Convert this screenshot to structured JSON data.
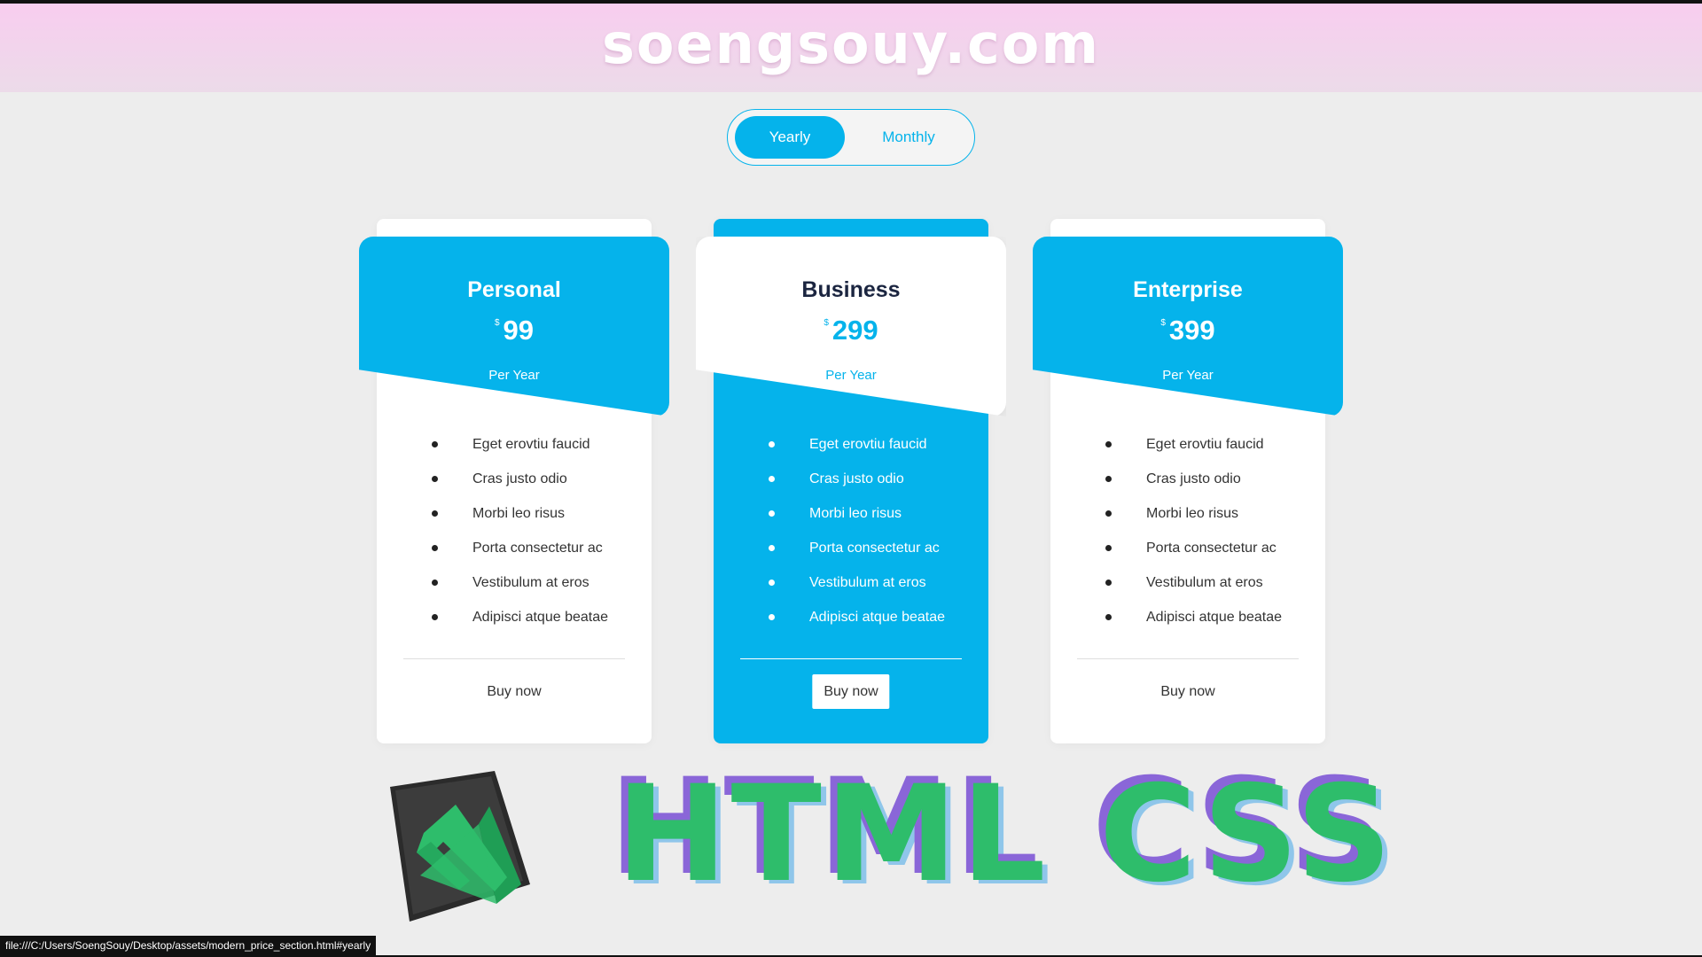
{
  "banner": {
    "title": "soengsouy.com"
  },
  "toggle": {
    "active": "Yearly",
    "inactive": "Monthly"
  },
  "colors": {
    "accent": "#05b3eb",
    "background": "#ededed",
    "banner": "#f8cdef",
    "logo_green": "#2ebd6b"
  },
  "plans": [
    {
      "name": "Personal",
      "currency": "$",
      "price": "99",
      "period": "Per Year",
      "features": [
        "Eget erovtiu faucid",
        "Cras justo odio",
        "Morbi leo risus",
        "Porta consectetur ac",
        "Vestibulum at eros",
        "Adipisci atque beatae"
      ],
      "button": "Buy now"
    },
    {
      "name": "Business",
      "currency": "$",
      "price": "299",
      "period": "Per Year",
      "features": [
        "Eget erovtiu faucid",
        "Cras justo odio",
        "Morbi leo risus",
        "Porta consectetur ac",
        "Vestibulum at eros",
        "Adipisci atque beatae"
      ],
      "button": "Buy now"
    },
    {
      "name": "Enterprise",
      "currency": "$",
      "price": "399",
      "period": "Per Year",
      "features": [
        "Eget erovtiu faucid",
        "Cras justo odio",
        "Morbi leo risus",
        "Porta consectetur ac",
        "Vestibulum at eros",
        "Adipisci atque beatae"
      ],
      "button": "Buy now"
    }
  ],
  "branding": {
    "text": "HTML CSS",
    "logo_icon": "vscode-logo-icon"
  },
  "status": {
    "url": "file:///C:/Users/SoengSouy/Desktop/assets/modern_price_section.html#yearly"
  }
}
